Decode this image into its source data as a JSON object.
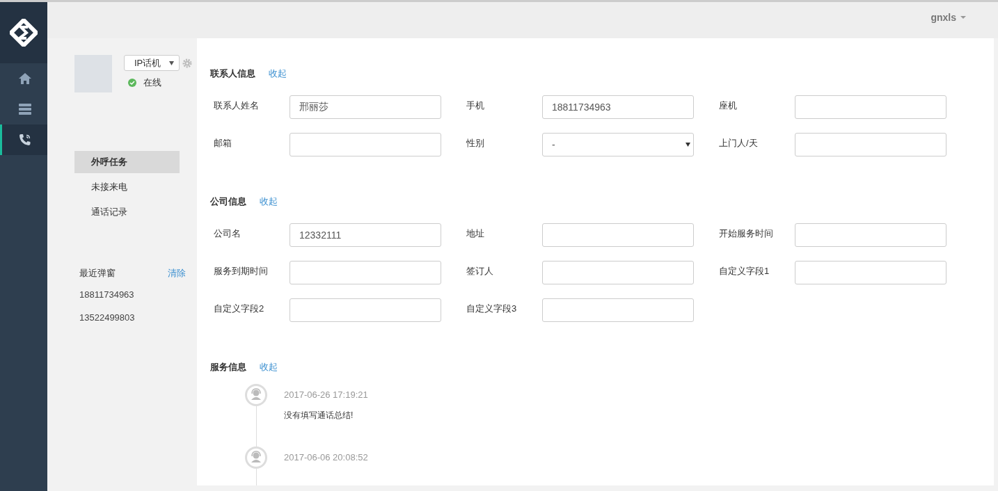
{
  "nav": [
    {
      "kind": "home",
      "selected": false
    },
    {
      "kind": "server",
      "selected": false
    },
    {
      "kind": "phone",
      "selected": true
    }
  ],
  "header": {
    "username": "gnxls"
  },
  "agent": {
    "phone_type": "IP话机",
    "status": "在线",
    "online": true
  },
  "menu": [
    {
      "label": "外呼任务",
      "selected": true
    },
    {
      "label": "未接来电",
      "selected": false
    },
    {
      "label": "通话记录",
      "selected": false
    }
  ],
  "recent": {
    "title": "最近弹窗",
    "clear": "清除",
    "numbers": [
      "18811734963",
      "13522499803"
    ]
  },
  "sections": [
    {
      "title": "联系人信息",
      "toggle": "收起",
      "fields": [
        {
          "label": "联系人姓名",
          "kind": "text",
          "value": "邢丽莎"
        },
        {
          "label": "手机",
          "kind": "text",
          "value": "18811734963"
        },
        {
          "label": "座机",
          "kind": "text"
        },
        {
          "label": "邮箱",
          "kind": "text"
        },
        {
          "label": "性别",
          "kind": "select",
          "value": "-"
        },
        {
          "label": "上门人/天",
          "kind": "text"
        }
      ]
    },
    {
      "title": "公司信息",
      "toggle": "收起",
      "fields": [
        {
          "label": "公司名",
          "kind": "text",
          "value": "12332111"
        },
        {
          "label": "地址",
          "kind": "text"
        },
        {
          "label": "开始服务时间",
          "kind": "text"
        },
        {
          "label": "服务到期时间",
          "kind": "text"
        },
        {
          "label": "签订人",
          "kind": "text"
        },
        {
          "label": "自定义字段1",
          "kind": "text"
        },
        {
          "label": "自定义字段2",
          "kind": "text"
        },
        {
          "label": "自定义字段3",
          "kind": "text"
        }
      ]
    }
  ],
  "service": {
    "title": "服务信息",
    "toggle": "收起",
    "entries": [
      {
        "time": "2017-06-26 17:19:21",
        "note": "没有填写通话总结!"
      },
      {
        "time": "2017-06-06 20:08:52"
      }
    ]
  }
}
